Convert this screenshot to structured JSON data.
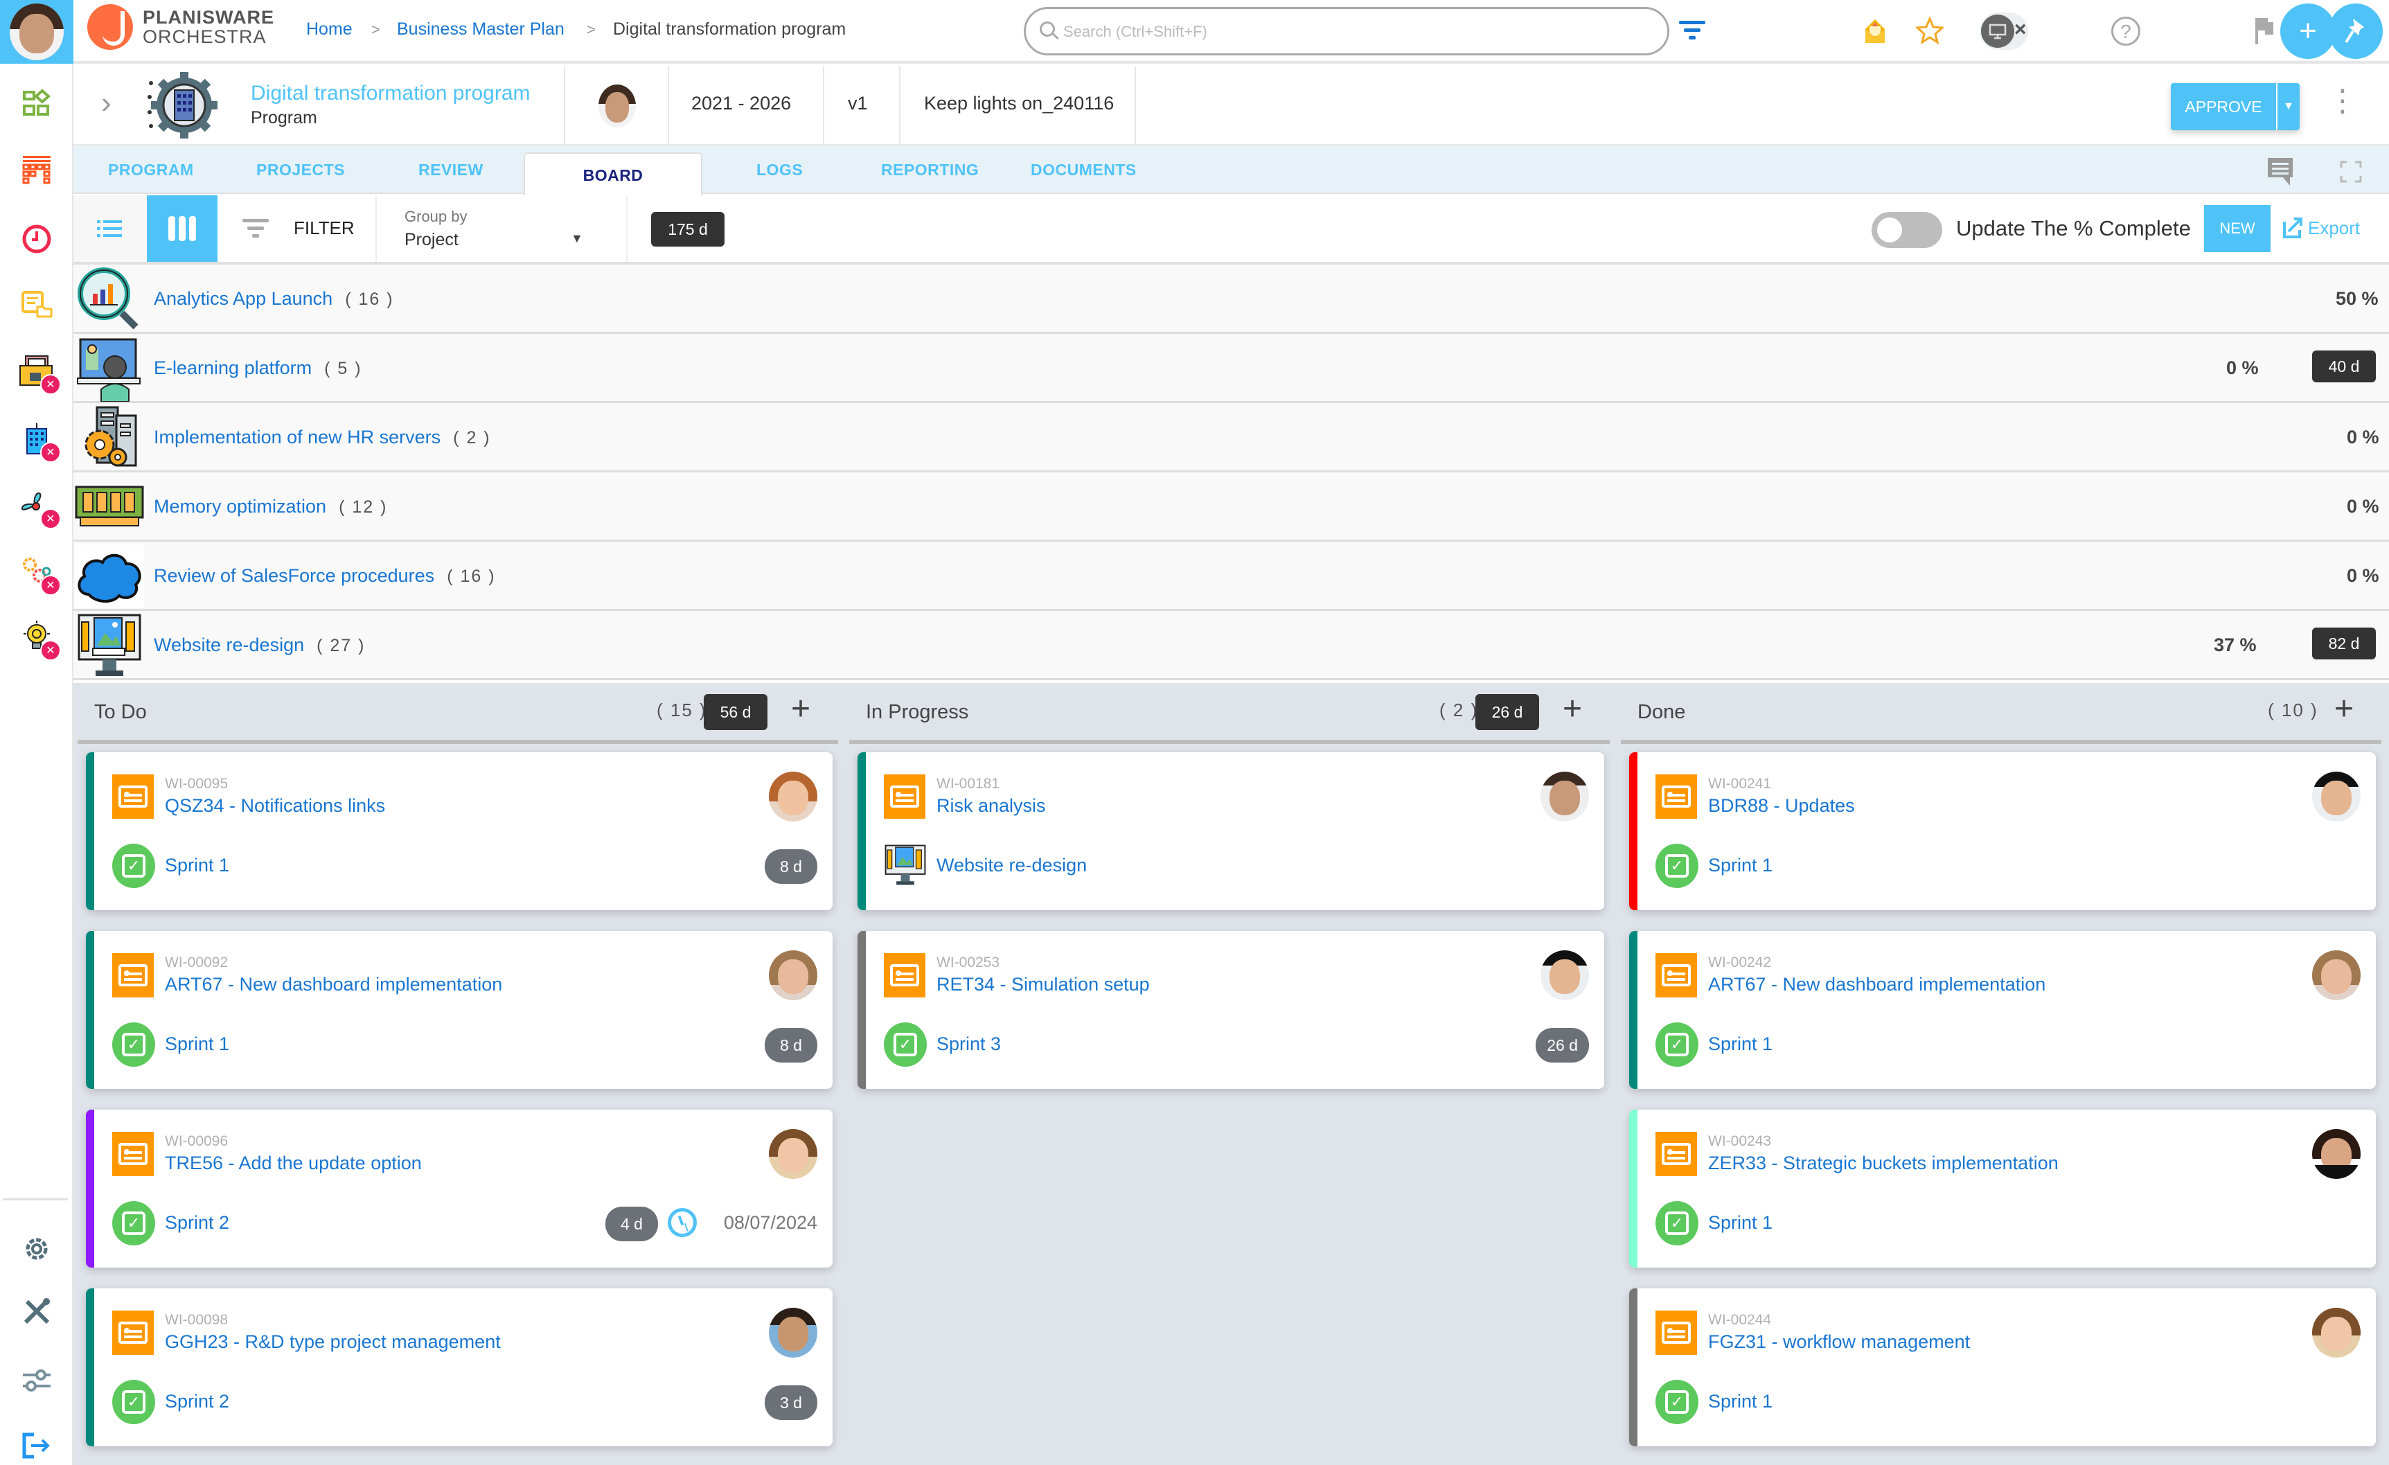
{
  "app": {
    "brand_line1": "PLANISWARE",
    "brand_line2": "ORCHESTRA",
    "accent_color": "#4fc3f7",
    "link_color": "#1976d2"
  },
  "breadcrumb": [
    {
      "label": "Home"
    },
    {
      "label": "Business Master Plan"
    },
    {
      "label": "Digital transformation program"
    }
  ],
  "breadcrumb_separator": ">",
  "search": {
    "placeholder": "Search (Ctrl+Shift+F)",
    "value": ""
  },
  "topbar_icons": [
    "mail-icon",
    "star-icon",
    "desktop-edit-icon",
    "close-icon",
    "help-icon",
    "flag-icon",
    "add-icon",
    "pin-icon"
  ],
  "close_glyph": "×",
  "help_glyph": "?",
  "add_glyph": "+",
  "pin_glyph": "📌",
  "sidebar": {
    "items": [
      {
        "icon": "portfolio-grid-icon",
        "pinned": false
      },
      {
        "icon": "gantt-chart-icon",
        "pinned": false
      },
      {
        "icon": "clock-icon",
        "pinned": false
      },
      {
        "icon": "documents-folder-icon",
        "pinned": false
      },
      {
        "icon": "hr-folder-icon",
        "pinned": true
      },
      {
        "icon": "building-icon",
        "pinned": true
      },
      {
        "icon": "fan-icon",
        "pinned": true
      },
      {
        "icon": "gears-cycle-icon",
        "pinned": true
      },
      {
        "icon": "idea-bulb-icon",
        "pinned": true
      }
    ],
    "bottom_items": [
      {
        "icon": "settings-icon"
      },
      {
        "icon": "tools-icon"
      },
      {
        "icon": "sliders-icon"
      },
      {
        "icon": "logout-icon"
      }
    ]
  },
  "program": {
    "title": "Digital transformation program",
    "type": "Program",
    "period": "2021 - 2026",
    "version": "v1",
    "scenario": "Keep lights on_240116",
    "approve_label": "APPROVE",
    "more_glyph": "⋮",
    "expand_glyph": "›"
  },
  "tabs": [
    {
      "label": "PROGRAM",
      "active": false
    },
    {
      "label": "PROJECTS",
      "active": false
    },
    {
      "label": "REVIEW",
      "active": false
    },
    {
      "label": "BOARD",
      "active": true
    },
    {
      "label": "LOGS",
      "active": false
    },
    {
      "label": "REPORTING",
      "active": false
    },
    {
      "label": "DOCUMENTS",
      "active": false
    }
  ],
  "toolbar": {
    "filter_label": "FILTER",
    "group_by_label": "Group by",
    "group_by_value": "Project",
    "total_duration": "175 d",
    "toggle_label": "Update The % Complete",
    "toggle_on": false,
    "new_label": "NEW",
    "export_label": "Export"
  },
  "groups": [
    {
      "name": "Analytics App Launch",
      "count": "( 16 )",
      "percent": "50 %",
      "duration": null,
      "icon": "analytics-magnifier-icon"
    },
    {
      "name": "E-learning platform",
      "count": "( 5 )",
      "percent": "0 %",
      "duration": "40 d",
      "icon": "e-learning-icon"
    },
    {
      "name": "Implementation of new HR servers",
      "count": "( 2 )",
      "percent": "0 %",
      "duration": null,
      "icon": "server-gears-icon"
    },
    {
      "name": "Memory optimization",
      "count": "( 12 )",
      "percent": "0 %",
      "duration": null,
      "icon": "memory-chip-icon"
    },
    {
      "name": "Review of SalesForce procedures",
      "count": "( 16 )",
      "percent": "0 %",
      "duration": null,
      "icon": "salesforce-cloud-icon"
    },
    {
      "name": "Website re-design",
      "count": "( 27 )",
      "percent": "37 %",
      "duration": "82 d",
      "icon": "web-design-icon"
    }
  ],
  "board": {
    "columns": [
      {
        "title": "To Do",
        "count": "( 15 )",
        "duration": "56 d",
        "cards": [
          {
            "id": "WI-00095",
            "title": "QSZ34 - Notifications links",
            "sprint": "Sprint 1",
            "duration": "8 d",
            "date": null,
            "stripe": "#00897b",
            "avatar": "woman-red-hair"
          },
          {
            "id": "WI-00092",
            "title": "ART67 - New dashboard implementation",
            "sprint": "Sprint 1",
            "duration": "8 d",
            "date": null,
            "stripe": "#00897b",
            "avatar": "woman-blonde"
          },
          {
            "id": "WI-00096",
            "title": "TRE56 - Add the update option",
            "sprint": "Sprint 2",
            "duration": "4 d",
            "date": "08/07/2024",
            "stripe": "#8e1aff",
            "avatar": "woman-long-hair"
          },
          {
            "id": "WI-00098",
            "title": "GGH23 - R&D type project management",
            "sprint": "Sprint 2",
            "duration": "3 d",
            "date": null,
            "stripe": "#00897b",
            "avatar": "man-blue-shirt"
          }
        ]
      },
      {
        "title": "In Progress",
        "count": "( 2 )",
        "duration": "26 d",
        "cards": [
          {
            "id": "WI-00181",
            "title": "Risk analysis",
            "sprint": "Website re-design",
            "sprint_icon": "web-design-icon",
            "duration": null,
            "date": null,
            "stripe": "#00897b",
            "avatar": "man-bald"
          },
          {
            "id": "WI-00253",
            "title": "RET34 - Simulation setup",
            "sprint": "Sprint 3",
            "duration": "26 d",
            "date": null,
            "stripe": "#777777",
            "avatar": "man-black-shirt"
          }
        ]
      },
      {
        "title": "Done",
        "count": "( 10 )",
        "duration": null,
        "cards": [
          {
            "id": "WI-00241",
            "title": "BDR88 - Updates",
            "sprint": "Sprint 1",
            "duration": null,
            "date": null,
            "stripe": "#ff0000",
            "avatar": "man-black-shirt"
          },
          {
            "id": "WI-00242",
            "title": "ART67 - New dashboard implementation",
            "sprint": "Sprint 1",
            "duration": null,
            "date": null,
            "stripe": "#00897b",
            "avatar": "woman-blonde"
          },
          {
            "id": "WI-00243",
            "title": "ZER33 - Strategic buckets implementation",
            "sprint": "Sprint 1",
            "duration": null,
            "date": null,
            "stripe": "#7fffd4",
            "avatar": "woman-dark-hair"
          },
          {
            "id": "WI-00244",
            "title": "FGZ31 - workflow management",
            "sprint": "Sprint 1",
            "duration": null,
            "date": null,
            "stripe": "#777777",
            "avatar": "woman-long-hair"
          }
        ]
      }
    ],
    "add_glyph": "+",
    "check_glyph": "✓"
  }
}
